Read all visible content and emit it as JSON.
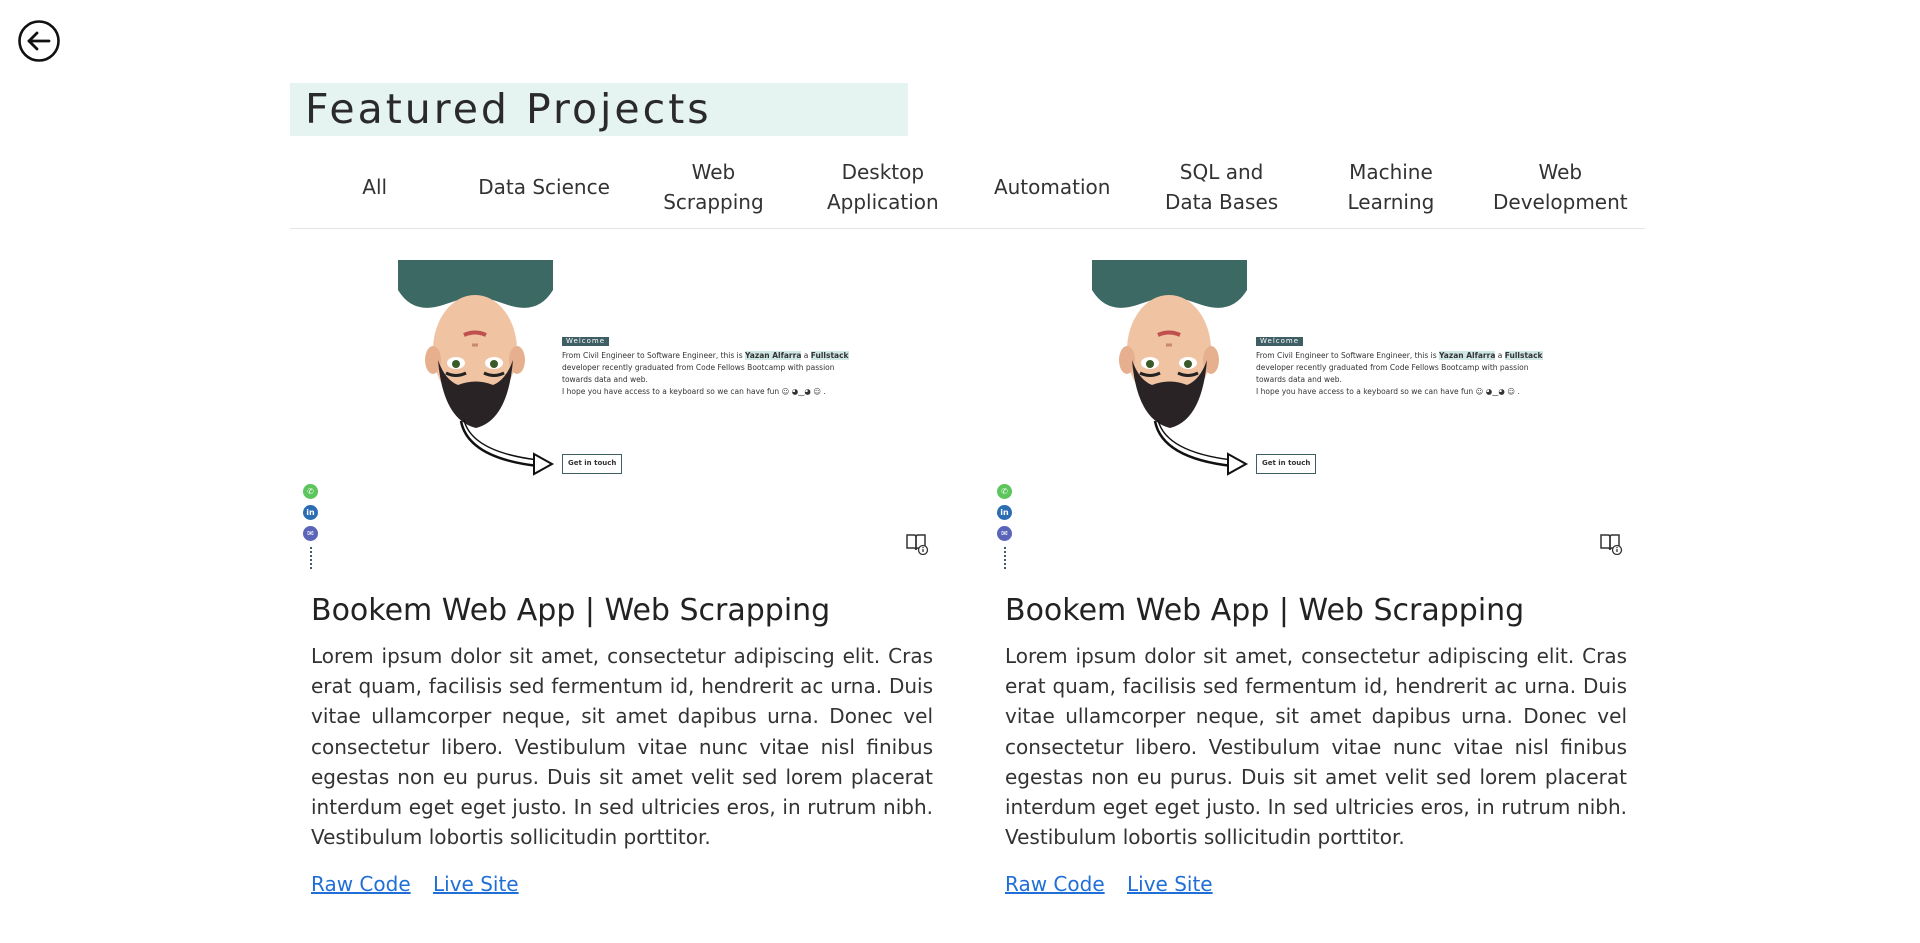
{
  "nav": {
    "back_icon": "arrow-left-circle-icon"
  },
  "header": {
    "title": "Featured Projects"
  },
  "filters": [
    {
      "label": "All"
    },
    {
      "label": "Data Science"
    },
    {
      "label": "Web\nScrapping"
    },
    {
      "label": "Desktop\nApplication"
    },
    {
      "label": "Automation"
    },
    {
      "label": "SQL and\nData Bases"
    },
    {
      "label": "Machine\nLearning"
    },
    {
      "label": "Web\nDevelopment"
    }
  ],
  "projects": [
    {
      "title": "Bookem Web App | Web Scrapping",
      "description": "Lorem ipsum dolor sit amet, consectetur adipiscing elit. Cras erat quam, facilisis sed fermentum id, hendrerit ac urna. Duis vitae ullamcorper neque, sit amet dapibus urna. Donec vel consectetur libero. Vestibulum vitae nunc vitae nisl finibus egestas non eu purus. Duis sit amet velit sed lorem placerat interdum eget eget justo. In sed ultricies eros, in rutrum nibh. Vestibulum lobortis sollicitudin porttitor.",
      "raw_code_label": "Raw Code",
      "live_site_label": "Live Site",
      "thumb": {
        "welcome_tag": "Welcome",
        "intro_start": "From Civil Engineer to Software Engineer, this is ",
        "name": "Yazan Alfarra",
        "intro_mid": " a ",
        "role": "Fullstack",
        "intro_end": " developer recently graduated from Code Fellows Bootcamp with passion towards data and web.",
        "line2": "I hope you have access to a keyboard so we can have fun ☺ ◕‿◕ ☺ .",
        "button": "Get in touch"
      }
    },
    {
      "title": "Bookem Web App | Web Scrapping",
      "description": "Lorem ipsum dolor sit amet, consectetur adipiscing elit. Cras erat quam, facilisis sed fermentum id, hendrerit ac urna. Duis vitae ullamcorper neque, sit amet dapibus urna. Donec vel consectetur libero. Vestibulum vitae nunc vitae nisl finibus egestas non eu purus. Duis sit amet velit sed lorem placerat interdum eget eget justo. In sed ultricies eros, in rutrum nibh. Vestibulum lobortis sollicitudin porttitor.",
      "raw_code_label": "Raw Code",
      "live_site_label": "Live Site",
      "thumb": {
        "welcome_tag": "Welcome",
        "intro_start": "From Civil Engineer to Software Engineer, this is ",
        "name": "Yazan Alfarra",
        "intro_mid": " a ",
        "role": "Fullstack",
        "intro_end": " developer recently graduated from Code Fellows Bootcamp with passion towards data and web.",
        "line2": "I hope you have access to a keyboard so we can have fun ☺ ◕‿◕ ☺ .",
        "button": "Get in touch"
      }
    }
  ]
}
